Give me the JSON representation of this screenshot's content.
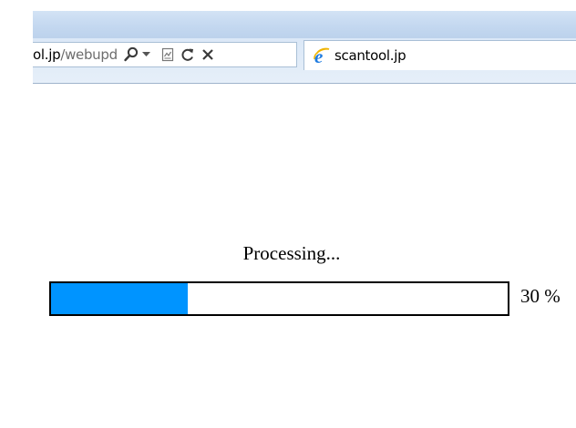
{
  "browser": {
    "address": {
      "domain": "ol.jp",
      "path": "/webupd",
      "buttons": {
        "search_icon": "search-icon",
        "dropdown_icon": "chevron-down-icon",
        "compat_icon": "compatibility-view-icon",
        "refresh_icon": "refresh-icon",
        "stop_icon": "close-icon"
      }
    },
    "tab": {
      "icon": "ie-icon",
      "label": "scantool.jp"
    }
  },
  "page": {
    "status_text": "Processing...",
    "progress": {
      "percent": 30,
      "label": "30 %",
      "fill_color": "#0094ff"
    }
  }
}
